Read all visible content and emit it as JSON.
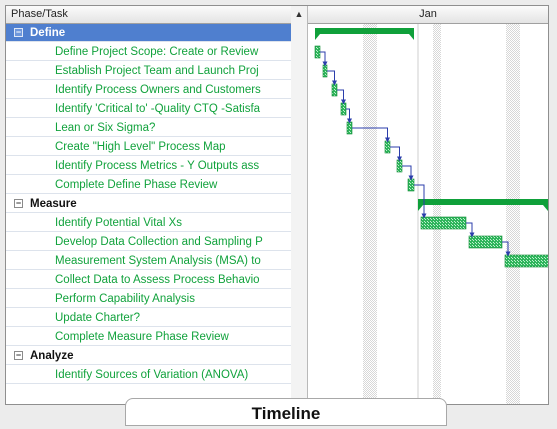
{
  "pane": {
    "header": "Phase/Task",
    "sort_arrow": "▲"
  },
  "gantt": {
    "month": "Jan",
    "summary_color": "#0fa03a",
    "task_color": "#46c46f",
    "link_color": "#2b3dab"
  },
  "rows": [
    {
      "type": "phase",
      "label": "Define",
      "selected": true,
      "toggle": "−"
    },
    {
      "type": "task",
      "label": "Define Project Scope: Create or Review"
    },
    {
      "type": "task",
      "label": "Establish Project Team and Launch Proj"
    },
    {
      "type": "task",
      "label": "Identify Process Owners and  Customers"
    },
    {
      "type": "task",
      "label": "Identify 'Critical to' -Quality CTQ -Satisfa"
    },
    {
      "type": "task",
      "label": "Lean or  Six Sigma?"
    },
    {
      "type": "task",
      "label": "Create \"High Level\" Process Map"
    },
    {
      "type": "task",
      "label": "Identify Process Metrics - Y Outputs ass"
    },
    {
      "type": "task",
      "label": "Complete Define Phase Review"
    },
    {
      "type": "phase",
      "label": "Measure",
      "selected": false,
      "toggle": "−"
    },
    {
      "type": "task",
      "label": "Identify Potential Vital Xs"
    },
    {
      "type": "task",
      "label": "Develop Data Collection and Sampling P"
    },
    {
      "type": "task",
      "label": "Measurement System Analysis (MSA) to"
    },
    {
      "type": "task",
      "label": "Collect Data to Assess Process Behavio"
    },
    {
      "type": "task",
      "label": "Perform Capability Analysis"
    },
    {
      "type": "task",
      "label": "Update  Charter?"
    },
    {
      "type": "task",
      "label": "Complete Measure Phase Review"
    },
    {
      "type": "phase",
      "label": "Analyze",
      "selected": false,
      "toggle": "−"
    },
    {
      "type": "task",
      "label": "Identify Sources of Variation (ANOVA)"
    }
  ],
  "bottom_tab": "Timeline"
}
